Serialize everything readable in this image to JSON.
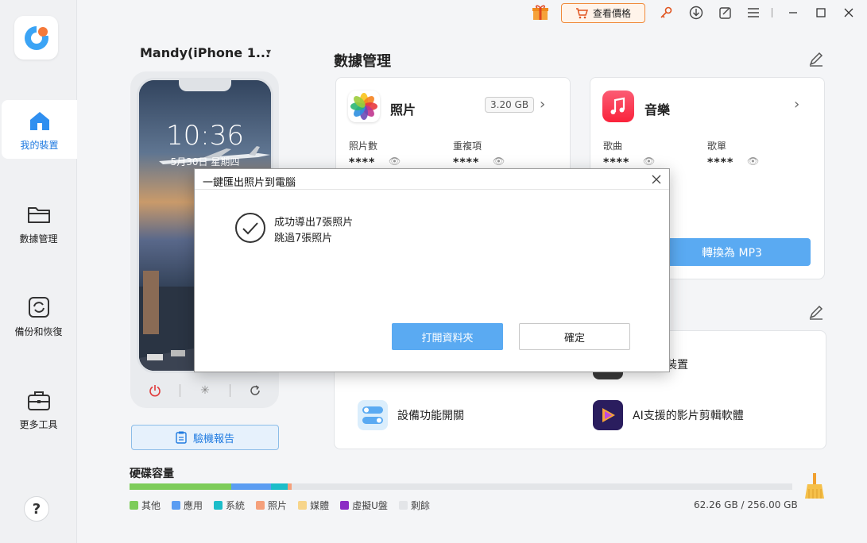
{
  "sidebar": {
    "items": [
      {
        "label": "我的裝置"
      },
      {
        "label": "數據管理"
      },
      {
        "label": "備份和恢復"
      },
      {
        "label": "更多工具"
      }
    ],
    "help": "?"
  },
  "topbar": {
    "price_label": "查看價格"
  },
  "device": {
    "name": "Mandy(iPhone 1...",
    "time": "10:36",
    "date": "5月30日 星期四",
    "report_label": "驗機報告"
  },
  "data_management": {
    "title": "數據管理",
    "photos": {
      "title": "照片",
      "size": "3.20 GB",
      "stat1_label": "照片數",
      "stat1_value": "****",
      "stat2_label": "重複項",
      "stat2_value": "****"
    },
    "music": {
      "title": "音樂",
      "stat1_label": "歌曲",
      "stat1_value": "****",
      "stat2_label": "歌單",
      "stat2_value": "****",
      "convert_label": "轉換為 MP3"
    }
  },
  "tools": {
    "transfer_label": "傳輸到裝置",
    "toggle_label": "設備功能開關",
    "ai_video_label": "AI支援的影片剪輯軟體"
  },
  "disk": {
    "title": "硬碟容量",
    "size_text": "62.26 GB / 256.00 GB",
    "segments": [
      {
        "name": "其他",
        "color": "#7dcc5a",
        "fraction": 0.153
      },
      {
        "name": "應用",
        "color": "#5b9df2",
        "fraction": 0.06
      },
      {
        "name": "系統",
        "color": "#1cbdc9",
        "fraction": 0.026
      },
      {
        "name": "照片",
        "color": "#f5a07b",
        "fraction": 0.006
      },
      {
        "name": "媒體",
        "color": "#f7d58b",
        "fraction": 0.0
      },
      {
        "name": "虛擬U盤",
        "color": "#8b2cc4",
        "fraction": 0.0
      },
      {
        "name": "剩餘",
        "color": "#e3e5e8",
        "fraction": 0.755
      }
    ]
  },
  "modal": {
    "title": "一鍵匯出照片到電腦",
    "line1": "成功導出7張照片",
    "line2": "跳過7張照片",
    "open_label": "打開資料夾",
    "ok_label": "確定"
  }
}
